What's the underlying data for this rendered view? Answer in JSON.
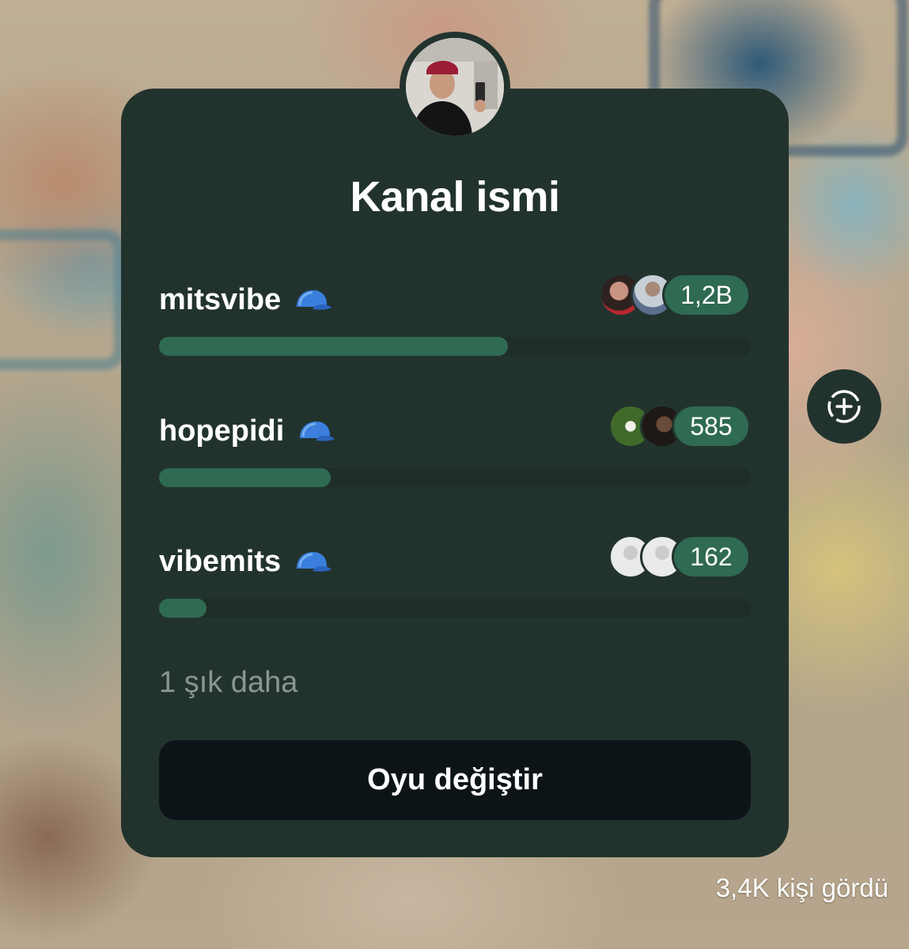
{
  "poll": {
    "title": "Kanal ismi",
    "options": [
      {
        "label": "mitsvibe",
        "emoji_icon": "blue-cap-icon",
        "count": "1,2B",
        "fill_fraction": 0.59
      },
      {
        "label": "hopepidi",
        "emoji_icon": "blue-cap-icon",
        "count": "585",
        "fill_fraction": 0.29
      },
      {
        "label": "vibemits",
        "emoji_icon": "blue-cap-icon",
        "count": "162",
        "fill_fraction": 0.08
      }
    ],
    "more_options_text": "1 şık daha",
    "change_vote_label": "Oyu değiştir"
  },
  "views_text": "3,4K kişi gördü",
  "side_action_icon": "add-sticker-icon",
  "colors": {
    "card_bg": "#22332e",
    "bar_fill": "#2f6a52",
    "button_bg": "#0d1418"
  }
}
